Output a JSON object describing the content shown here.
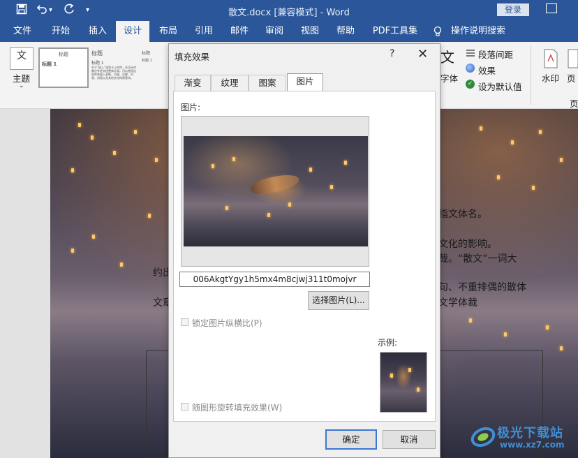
{
  "titlebar": {
    "title": "散文.docx [兼容模式]  -  Word",
    "login": "登录",
    "undo_dropdown": "▾",
    "customize": "▾"
  },
  "tabs": [
    "文件",
    "开始",
    "插入",
    "设计",
    "布局",
    "引用",
    "邮件",
    "审阅",
    "视图",
    "帮助",
    "PDF工具集",
    "操作说明搜索"
  ],
  "active_tab": "设计",
  "ribbon": {
    "theme_label": "主题",
    "theme_glyph": "文",
    "style1_title": "标题",
    "style1_heading": "标题 1",
    "style2_title": "标题",
    "style2_heading": "标题 1",
    "style2_body": "对于“插入”选项卡上的库，在设计时都应考虑文档整体外观。可以使用这些库来插入表格、页眉、页脚、列表、封面以及其他文档构建基块。",
    "style3_title": "标题",
    "style3_heading": "标题 1",
    "fonts_glyph": "文",
    "fonts_label": "字体",
    "para_spacing": "段落间距",
    "effects": "效果",
    "set_default": "设为默认值",
    "watermark": "水印",
    "page_color_short": "页",
    "page_bg_short": "页"
  },
  "document": {
    "line1": "指文体名。",
    "line2": "文化的影响。",
    "line3": "哉。“散文”一词大",
    "line4_start": "约出",
    "line5_end": "句、不重排偶的散体",
    "line6_start": "文章",
    "line6_end": "文学体裁"
  },
  "dialog": {
    "title": "填充效果",
    "help": "?",
    "close": "✕",
    "tabs": [
      "渐变",
      "纹理",
      "图案",
      "图片"
    ],
    "active_tab": "图片",
    "picture_label": "图片:",
    "filename": "006AkgtYgy1h5mx4m8cjwj311t0mojvr",
    "select_button": "选择图片(L)...",
    "lock_aspect": "锁定图片纵横比(P)",
    "lock_aspect_checked": false,
    "rotate_with_shape": "随图形旋转填充效果(W)",
    "rotate_with_shape_checked": false,
    "sample_label": "示例:",
    "ok": "确定",
    "cancel": "取消"
  },
  "watermark": {
    "site_name": "极光下载站",
    "url": "www.xz7.com"
  }
}
